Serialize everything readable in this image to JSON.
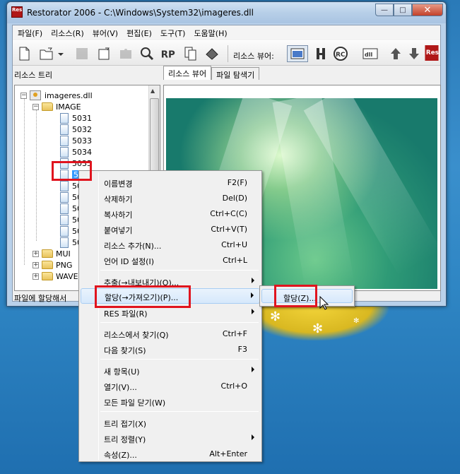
{
  "window": {
    "title": "Restorator 2006 - C:\\Windows\\System32\\imageres.dll",
    "app_icon_text": "Res",
    "controls": {
      "minimize": "—",
      "maximize": "□",
      "close": "✕"
    }
  },
  "menubar": [
    "파일(F)",
    "리소스(R)",
    "뷰어(V)",
    "편집(E)",
    "도구(T)",
    "도움말(H)"
  ],
  "toolbar": {
    "viewer_label": "리소스 뷰어:",
    "buttons": [
      "new-icon",
      "open-folder-icon",
      "dropdown-arrow-icon",
      "save-icon",
      "export-icon",
      "puzzle-icon",
      "search-icon",
      "rp-icon",
      "copy-icon",
      "book-icon",
      "viewer-mode-icon",
      "hex-icon",
      "rc-icon",
      "dll-icon",
      "up-arrow-icon",
      "down-arrow-icon",
      "res-logo-icon"
    ]
  },
  "tree": {
    "header": "리소스 트리",
    "root": "imageres.dll",
    "image_folder": "IMAGE",
    "items": [
      "5031",
      "5032",
      "5033",
      "5034",
      "5035",
      "5036"
    ],
    "hidden_items": [
      "50",
      "50",
      "50",
      "50",
      "50",
      "50"
    ],
    "folders_below": [
      "MUI",
      "PNG",
      "WAVE"
    ]
  },
  "tabs": [
    "리소스 뷰어",
    "파일 탐색기"
  ],
  "status": "파일에 할당해서",
  "context_menu": {
    "items": [
      {
        "label": "이름변경",
        "shortcut": "F2(F)"
      },
      {
        "label": "삭제하기",
        "shortcut": "Del(D)"
      },
      {
        "label": "복사하기",
        "shortcut": "Ctrl+C(C)"
      },
      {
        "label": "붙여넣기",
        "shortcut": "Ctrl+V(T)"
      },
      {
        "label": "리소스 추가(N)...",
        "shortcut": "Ctrl+U"
      },
      {
        "label": "언어 ID 설정(I)",
        "shortcut": "Ctrl+L"
      },
      {
        "label": "추출(→내보내기)(O)...",
        "shortcut": ""
      },
      {
        "label": "할당(→가져오기)(P)...",
        "shortcut": ""
      },
      {
        "label": "RES 파일(R)",
        "shortcut": ""
      },
      {
        "label": "리소스에서 찾기(Q)",
        "shortcut": "Ctrl+F"
      },
      {
        "label": "다음 찾기(S)",
        "shortcut": "F3"
      },
      {
        "label": "새 항목(U)",
        "shortcut": ""
      },
      {
        "label": "열기(V)...",
        "shortcut": "Ctrl+O"
      },
      {
        "label": "모든 파일 닫기(W)",
        "shortcut": ""
      },
      {
        "label": "트리 접기(X)",
        "shortcut": ""
      },
      {
        "label": "트리 정렬(Y)",
        "shortcut": ""
      },
      {
        "label": "속성(Z)...",
        "shortcut": "Alt+Enter"
      }
    ]
  },
  "submenu": {
    "item": "할당(Z)..."
  },
  "colors": {
    "highlight": "#e0141e",
    "selection": "#3399ff",
    "desktop": "#2a7ab8"
  }
}
